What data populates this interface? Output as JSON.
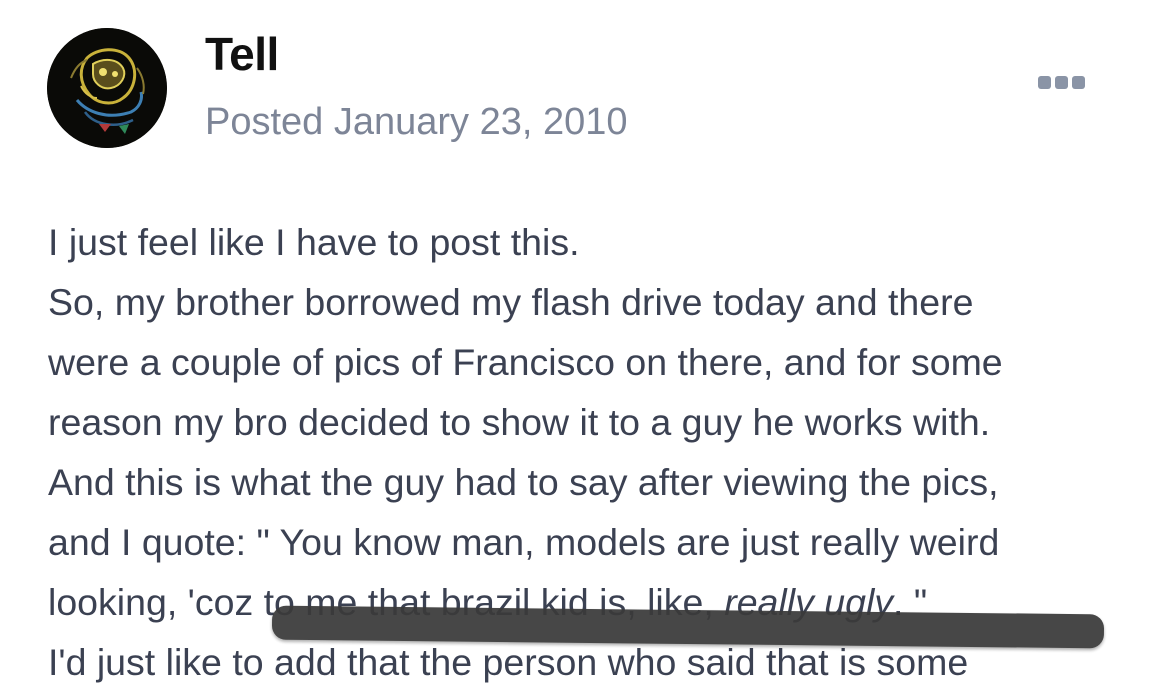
{
  "post": {
    "author": "Tell",
    "posted": "Posted January 23, 2010",
    "more_icon": "ellipsis-icon",
    "lines": [
      "I just feel like I have to post this.",
      "So, my brother borrowed my flash drive today and there",
      "were a couple of pics of Francisco on there, and for some",
      "reason my bro decided to show it to a guy he works with.",
      "And this is what the guy had to say after viewing the pics,",
      "and I quote: \" You know man, models are just really weird"
    ],
    "quote_line": {
      "before": "looking, 'coz to me that brazil kid is, like, ",
      "emphasis": "really ugly",
      "after": ". \""
    },
    "cut_line": "I'd just like to add that the person who said that is some"
  }
}
